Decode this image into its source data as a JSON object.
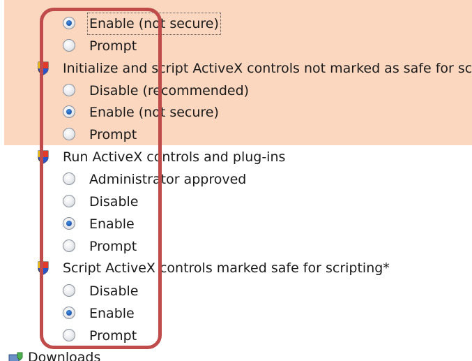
{
  "settings": {
    "first_group": {
      "options": [
        {
          "label": "Enable (not secure)",
          "checked": true,
          "focused": true
        },
        {
          "label": "Prompt",
          "checked": false
        }
      ]
    },
    "groups": [
      {
        "title": "Initialize and script ActiveX controls not marked as safe for scripting",
        "highlighted": true,
        "options": [
          {
            "label": "Disable (recommended)",
            "checked": false
          },
          {
            "label": "Enable (not secure)",
            "checked": true
          },
          {
            "label": "Prompt",
            "checked": false
          }
        ]
      },
      {
        "title": "Run ActiveX controls and plug-ins",
        "highlighted": false,
        "options": [
          {
            "label": "Administrator approved",
            "checked": false
          },
          {
            "label": "Disable",
            "checked": false
          },
          {
            "label": "Enable",
            "checked": true
          },
          {
            "label": "Prompt",
            "checked": false
          }
        ]
      },
      {
        "title": "Script ActiveX controls marked safe for scripting*",
        "highlighted": false,
        "options": [
          {
            "label": "Disable",
            "checked": false
          },
          {
            "label": "Enable",
            "checked": true
          },
          {
            "label": "Prompt",
            "checked": false
          }
        ]
      }
    ],
    "next_category": {
      "title": "Downloads",
      "icon": "downloads-icon"
    }
  },
  "colors": {
    "highlight": "#fbd7bf",
    "callout_border": "#bf4b4b",
    "radio_selected": "#1d5db8"
  },
  "icons": {
    "group": "shield-icon",
    "radio": "radio-button"
  }
}
